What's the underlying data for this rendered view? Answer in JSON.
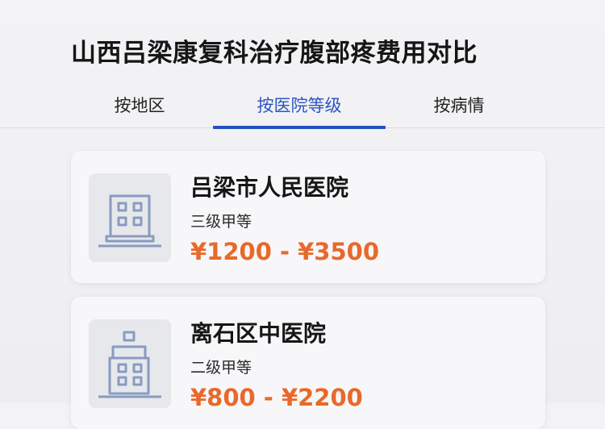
{
  "title": "山西吕梁康复科治疗腹部疼费用对比",
  "tabs": [
    {
      "label": "按地区",
      "active": false
    },
    {
      "label": "按医院等级",
      "active": true
    },
    {
      "label": "按病情",
      "active": false
    }
  ],
  "hospitals": [
    {
      "name": "吕梁市人民医院",
      "level": "三级甲等",
      "price": "¥1200 - ¥3500",
      "icon": "hospital-building-icon"
    },
    {
      "name": "离石区中医院",
      "level": "二级甲等",
      "price": "¥800 - ¥2200",
      "icon": "hospital-building-flag-icon"
    }
  ],
  "colors": {
    "accent": "#2450c2",
    "price": "#e8692a",
    "icon_stroke": "#8a9bbf"
  }
}
